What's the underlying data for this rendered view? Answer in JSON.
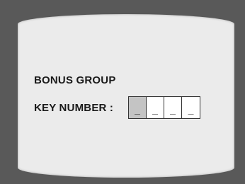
{
  "menu": {
    "title": "BONUS GROUP",
    "key_label": "KEY NUMBER :"
  },
  "key_number": {
    "digits": [
      "_",
      "_",
      "_",
      "_"
    ],
    "active_index": 0
  },
  "colors": {
    "frame": "#595959",
    "screen": "#ebebeb",
    "text": "#1a1a1a",
    "active_cell": "#c4c4c4"
  }
}
